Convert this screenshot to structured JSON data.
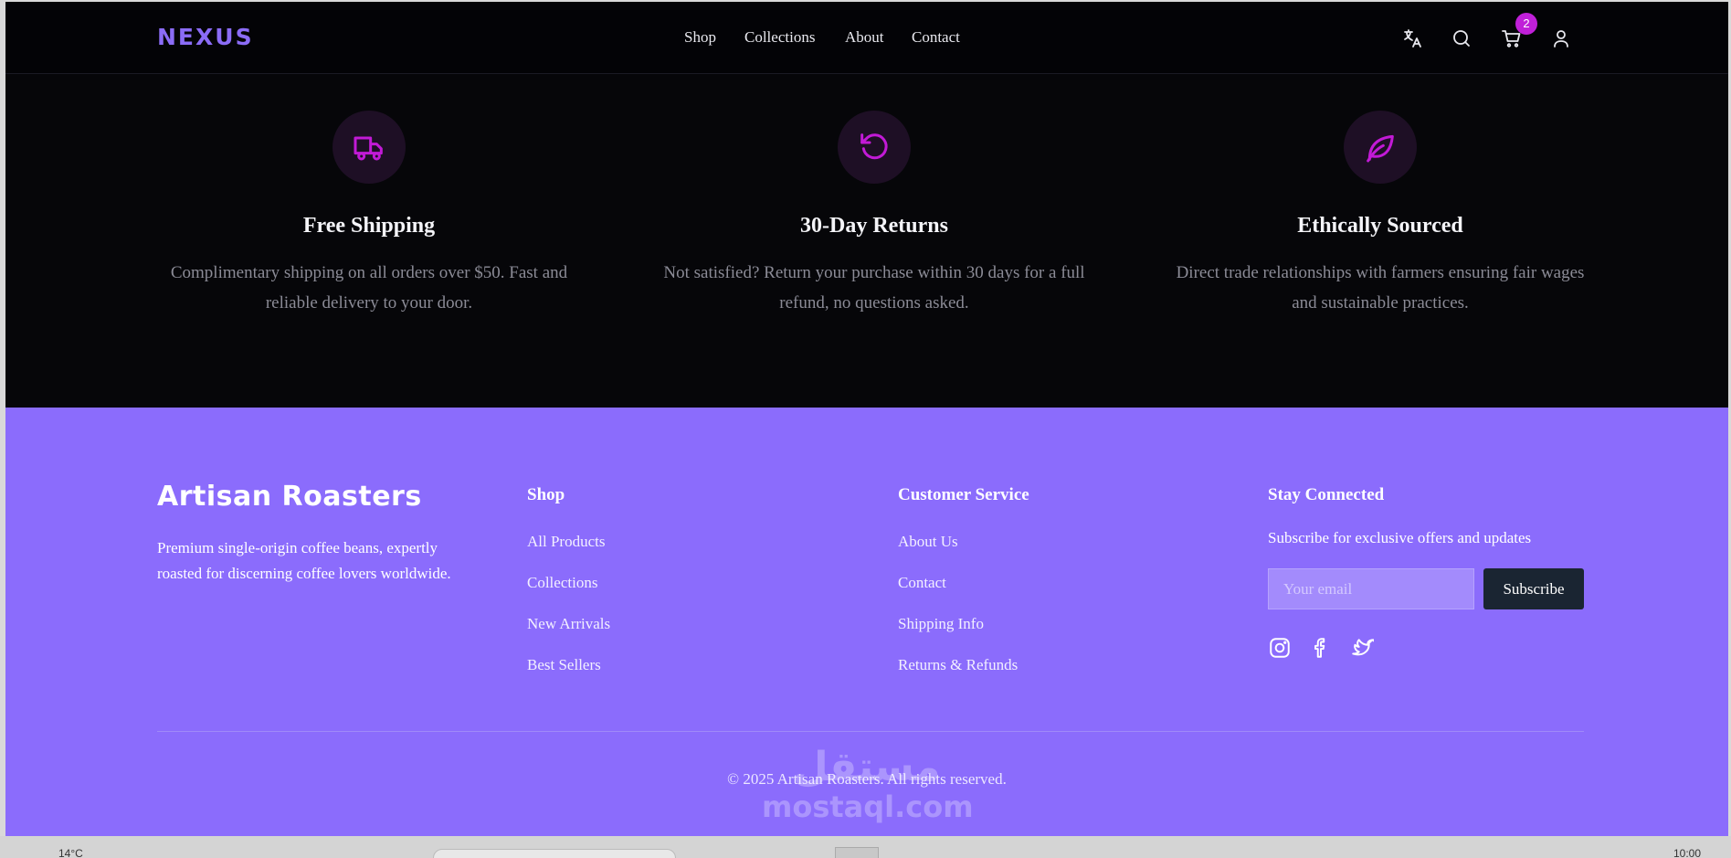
{
  "header": {
    "logo": "NEXUS",
    "nav": [
      "Shop",
      "Collections",
      "About",
      "Contact"
    ],
    "icons": [
      "translate-icon",
      "search-icon",
      "cart-icon",
      "user-icon"
    ],
    "cart_count": "2"
  },
  "features": [
    {
      "icon": "truck-icon",
      "title": "Free Shipping",
      "line1": "Complimentary shipping on all orders over $50. Fast and",
      "line2": "reliable delivery to your door."
    },
    {
      "icon": "rotate-ccw-icon",
      "title": "30-Day Returns",
      "line1": "Not satisfied? Return your purchase within 30 days for a full",
      "line2": "refund, no questions asked."
    },
    {
      "icon": "leaf-icon",
      "title": "Ethically Sourced",
      "line1": "Direct trade relationships with farmers ensuring fair wages",
      "line2": "and sustainable practices."
    }
  ],
  "footer": {
    "brand": "Artisan Roasters",
    "brand_line1": "Premium single-origin coffee beans, expertly",
    "brand_line2": "roasted for discerning coffee lovers worldwide.",
    "shop": {
      "title": "Shop",
      "links": [
        "All Products",
        "Collections",
        "New Arrivals",
        "Best Sellers"
      ]
    },
    "service": {
      "title": "Customer Service",
      "links": [
        "About Us",
        "Contact",
        "Shipping Info",
        "Returns & Refunds"
      ]
    },
    "connect": {
      "title": "Stay Connected",
      "text": "Subscribe for exclusive offers and updates",
      "email_placeholder": "Your email",
      "button": "Subscribe",
      "social": [
        "instagram-icon",
        "facebook-icon",
        "twitter-icon"
      ]
    },
    "copyright": "© 2025 Artisan Roasters. All rights reserved."
  },
  "watermark": {
    "arabic": "مستقل",
    "latin": "mostaql.com"
  },
  "taskbar": {
    "left_text": "14°C",
    "time": "10:00"
  },
  "colors": {
    "brand_purple": "#8b6cf6",
    "footer_bg": "#8b6cfc",
    "accent_magenta": "#c020d8",
    "dark_bg": "#060609",
    "button_dark": "#1a2532"
  }
}
